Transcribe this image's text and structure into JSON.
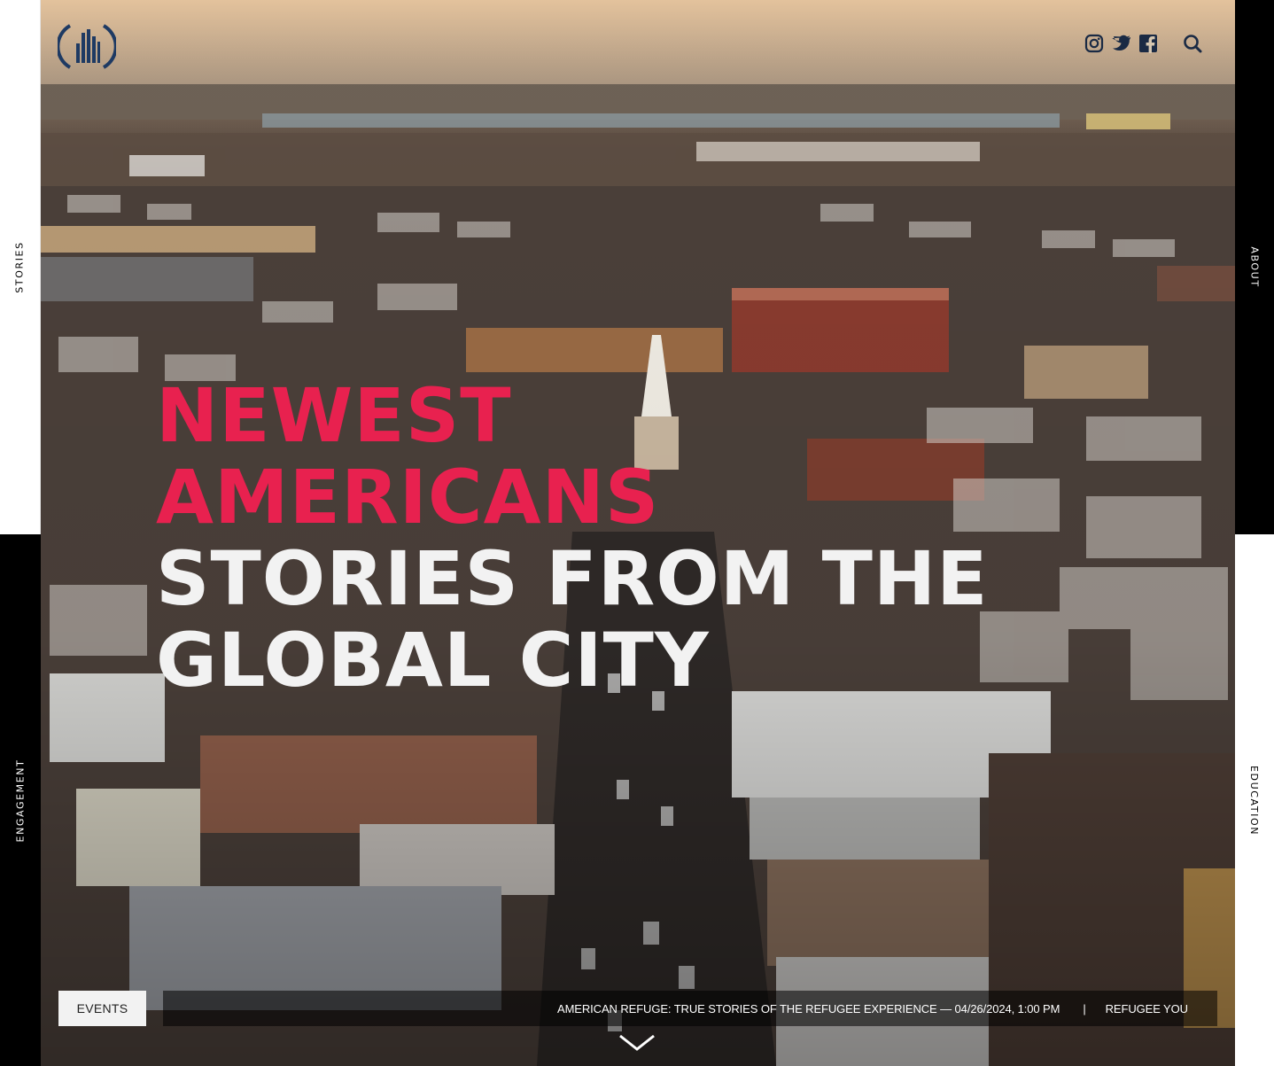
{
  "nav": {
    "stories_label": "STORIES",
    "engagement_label": "ENGAGEMENT",
    "about_label": "ABOUT",
    "education_label": "EDUCATION"
  },
  "header": {
    "logo_icon": "newest-americans-logo-icon",
    "social_icons": [
      "instagram-icon",
      "twitter-icon",
      "facebook-icon"
    ],
    "search_icon": "search-icon"
  },
  "hero": {
    "line1": "NEWEST",
    "line2": "AMERICANS",
    "line3": "STORIES FROM THE",
    "line4": "GLOBAL CITY",
    "accent_color": "#e8214f"
  },
  "ticker": {
    "events_label": "EVENTS",
    "item1": "AMERICAN REFUGE: TRUE STORIES OF THE REFUGEE EXPERIENCE — 04/26/2024, 1:00 PM",
    "separator": "|",
    "item2": "REFUGEE YOU"
  },
  "scroll_icon": "chevron-down-icon"
}
